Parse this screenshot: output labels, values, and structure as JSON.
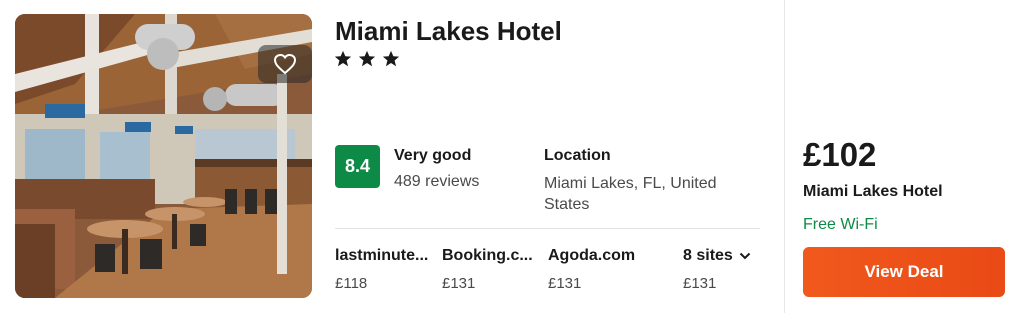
{
  "hotel": {
    "name": "Miami Lakes Hotel",
    "stars": 3,
    "score": "8.4",
    "rating_label": "Very good",
    "reviews": "489 reviews",
    "location_label": "Location",
    "location_value": "Miami Lakes, FL, United States"
  },
  "sites": [
    {
      "name": "lastminute...",
      "price": "£118"
    },
    {
      "name": "Booking.c...",
      "price": "£131"
    },
    {
      "name": "Agoda.com",
      "price": "£131"
    },
    {
      "name": "8 sites",
      "price": "£131"
    }
  ],
  "deal": {
    "price": "£102",
    "provider": "Miami Lakes Hotel",
    "amenity": "Free Wi-Fi",
    "button_label": "View Deal"
  },
  "colors": {
    "score_badge": "#0e8a47",
    "amenity_text": "#0e8a47",
    "deal_button": "#ea4a16"
  },
  "icons": {
    "favorite": "heart-outline-icon",
    "star": "star-icon",
    "more_sites": "chevron-down-icon"
  }
}
